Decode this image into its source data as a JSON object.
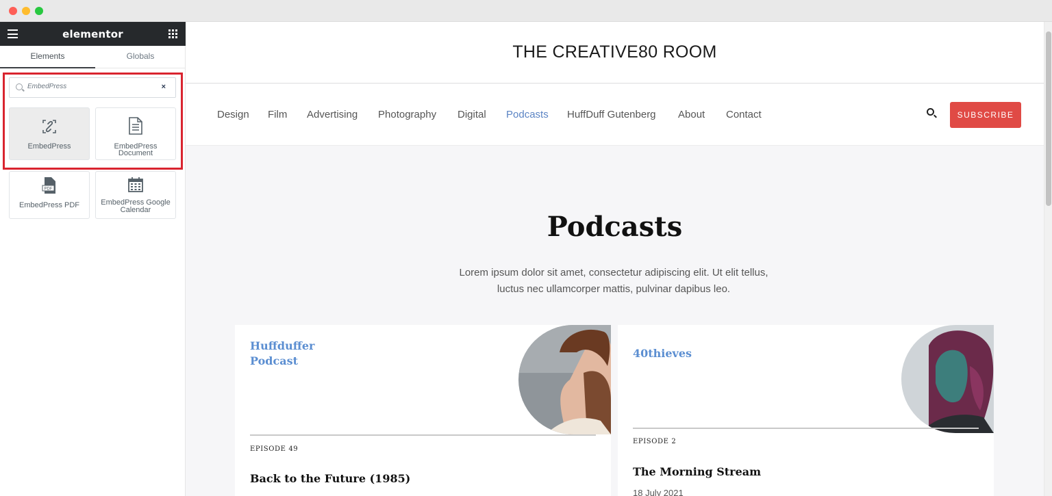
{
  "panel": {
    "brand": "elementor",
    "tabs": [
      "Elements",
      "Globals"
    ],
    "search": {
      "value": "EmbedPress",
      "clear": "×"
    },
    "widgets": [
      {
        "label": "EmbedPress",
        "icon": "embedpress-link-icon"
      },
      {
        "label": "EmbedPress Document",
        "icon": "document-icon"
      },
      {
        "label": "EmbedPress PDF",
        "icon": "pdf-file-icon",
        "icon_text": "PDF"
      },
      {
        "label_line1": "EmbedPress Google",
        "label_line2": "Calendar",
        "icon": "calendar-icon"
      }
    ],
    "collapse": "‹"
  },
  "site": {
    "title": "THE CREATIVE80 ROOM",
    "nav": [
      "Design",
      "Film",
      "Advertising",
      "Photography",
      "Digital",
      "Podcasts",
      "HuffDuff Gutenberg",
      "About",
      "Contact"
    ],
    "active_nav": "Podcasts",
    "subscribe": "SUBSCRIBE",
    "hero": {
      "title": "Podcasts",
      "text_line1": "Lorem ipsum dolor sit amet, consectetur adipiscing elit. Ut elit tellus,",
      "text_line2": "luctus nec ullamcorper mattis, pulvinar dapibus leo."
    },
    "cards": [
      {
        "title_line1": "Huffduffer",
        "title_line2": "Podcast",
        "episode": "EPISODE 49",
        "episode_title": "Back to the Future (1985)"
      },
      {
        "title_line1": "40thieves",
        "episode": "EPISODE 2",
        "episode_title": "The Morning Stream",
        "date": "18 July 2021"
      }
    ]
  },
  "colors": {
    "accent_link": "#5b8ed1",
    "subscribe": "#e04a45",
    "highlight": "#d9242f",
    "panel_header": "#26292c"
  }
}
